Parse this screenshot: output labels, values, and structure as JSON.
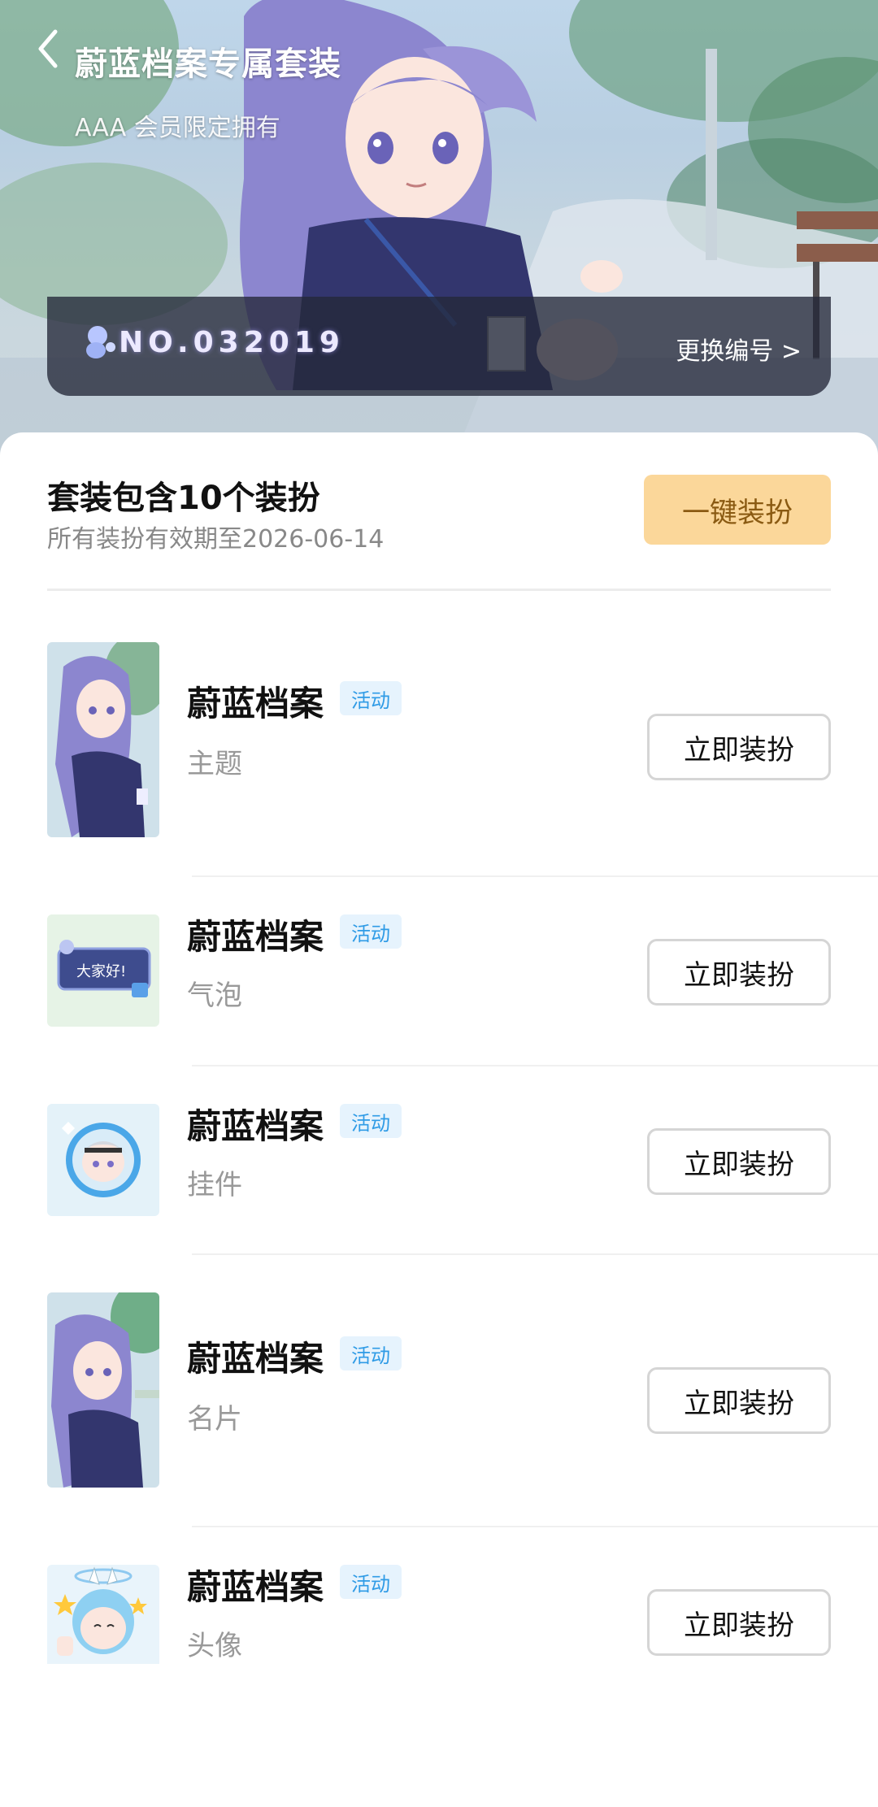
{
  "header": {
    "title": "蔚蓝档案专属套装",
    "subtitle": "AAA 会员限定拥有",
    "serial_number": "NO.032019",
    "change_number_label": "更换编号 >"
  },
  "summary": {
    "title": "套装包含10个装扮",
    "validity": "所有装扮有效期至2026-06-14",
    "one_key_button": "一键装扮"
  },
  "items": [
    {
      "name": "蔚蓝档案",
      "tag": "活动",
      "type": "主题",
      "button": "立即装扮",
      "thumb": "character-theme-thumbnail"
    },
    {
      "name": "蔚蓝档案",
      "tag": "活动",
      "type": "气泡",
      "button": "立即装扮",
      "thumb": "bubble-thumbnail",
      "bubble_text": "大家好!"
    },
    {
      "name": "蔚蓝档案",
      "tag": "活动",
      "type": "挂件",
      "button": "立即装扮",
      "thumb": "pendant-thumbnail"
    },
    {
      "name": "蔚蓝档案",
      "tag": "活动",
      "type": "名片",
      "button": "立即装扮",
      "thumb": "card-thumbnail"
    },
    {
      "name": "蔚蓝档案",
      "tag": "活动",
      "type": "头像",
      "button": "立即装扮",
      "thumb": "avatar-thumbnail"
    }
  ],
  "colors": {
    "accent_button_bg": "#fbd79a",
    "accent_button_text": "#8a5a12",
    "tag_bg": "#e6f3fd",
    "tag_text": "#2f9be6"
  }
}
